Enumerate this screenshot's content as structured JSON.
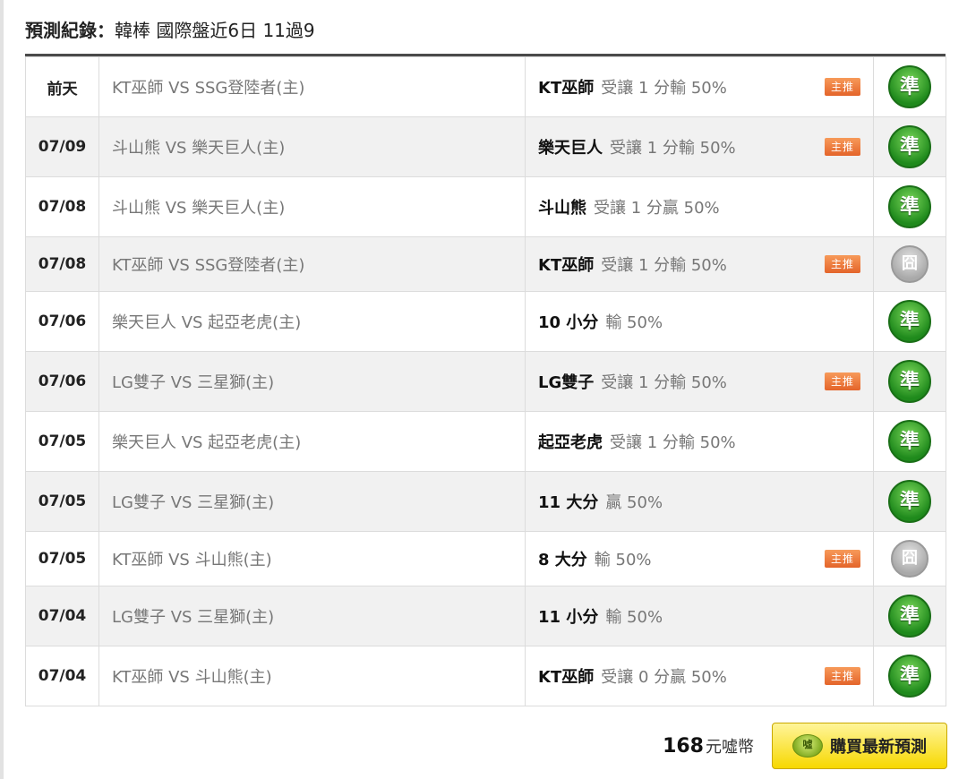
{
  "header": {
    "label": "預測紀錄：",
    "title": "韓棒 國際盤近6日 11過9"
  },
  "records": [
    {
      "date": "前天",
      "match": "KT巫師 VS SSG登陸者(主)",
      "pick_team": "KT巫師",
      "pick_detail": "受讓 1 分輸 50%",
      "badge": "主推",
      "result": "準"
    },
    {
      "date": "07/09",
      "match": "斗山熊 VS 樂天巨人(主)",
      "pick_team": "樂天巨人",
      "pick_detail": "受讓 1 分輸 50%",
      "badge": "主推",
      "result": "準"
    },
    {
      "date": "07/08",
      "match": "斗山熊 VS 樂天巨人(主)",
      "pick_team": "斗山熊",
      "pick_detail": "受讓 1 分贏 50%",
      "badge": "",
      "result": "準"
    },
    {
      "date": "07/08",
      "match": "KT巫師 VS SSG登陸者(主)",
      "pick_team": "KT巫師",
      "pick_detail": "受讓 1 分輸 50%",
      "badge": "主推",
      "result": "囧"
    },
    {
      "date": "07/06",
      "match": "樂天巨人 VS 起亞老虎(主)",
      "pick_team": "10 小分",
      "pick_detail": "輸 50%",
      "badge": "",
      "result": "準"
    },
    {
      "date": "07/06",
      "match": "LG雙子 VS 三星獅(主)",
      "pick_team": "LG雙子",
      "pick_detail": "受讓 1 分輸 50%",
      "badge": "主推",
      "result": "準"
    },
    {
      "date": "07/05",
      "match": "樂天巨人 VS 起亞老虎(主)",
      "pick_team": "起亞老虎",
      "pick_detail": "受讓 1 分輸 50%",
      "badge": "",
      "result": "準"
    },
    {
      "date": "07/05",
      "match": "LG雙子 VS 三星獅(主)",
      "pick_team": "11 大分",
      "pick_detail": "贏 50%",
      "badge": "",
      "result": "準"
    },
    {
      "date": "07/05",
      "match": "KT巫師 VS 斗山熊(主)",
      "pick_team": "8 大分",
      "pick_detail": "輸 50%",
      "badge": "主推",
      "result": "囧"
    },
    {
      "date": "07/04",
      "match": "LG雙子 VS 三星獅(主)",
      "pick_team": "11 小分",
      "pick_detail": "輸 50%",
      "badge": "",
      "result": "準"
    },
    {
      "date": "07/04",
      "match": "KT巫師 VS 斗山熊(主)",
      "pick_team": "KT巫師",
      "pick_detail": "受讓 0 分贏 50%",
      "badge": "主推",
      "result": "準"
    }
  ],
  "footer": {
    "price": "168",
    "price_unit": "元噓幣",
    "coin_icon_text": "噓",
    "buy_label": "購買最新預測"
  },
  "icons": {
    "hit": "green-circle-check-icon",
    "miss": "grey-circle-fail-icon",
    "coin": "green-coin-icon"
  },
  "colors": {
    "badge": "#e4642a",
    "hit": "#1f8a1c",
    "miss": "#a9a9a9",
    "buy_button": "#f7d800"
  }
}
